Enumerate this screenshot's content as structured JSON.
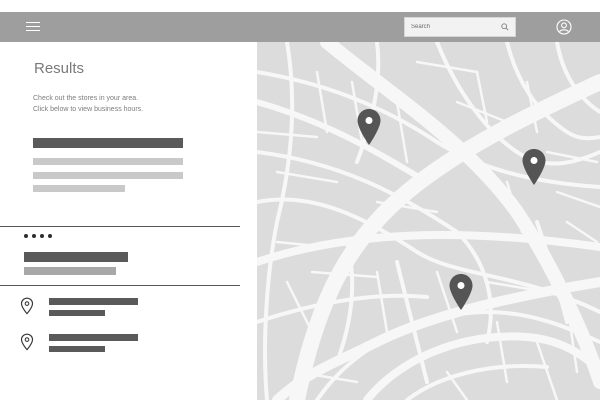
{
  "header": {
    "menu_icon": "hamburger-menu-icon",
    "search": {
      "placeholder": "Search",
      "icon": "search-icon"
    },
    "user_icon": "user-account-icon"
  },
  "results": {
    "title": "Results",
    "intro_lines": [
      "Check out the stores in your area.",
      "Click below to view business hours."
    ],
    "more_icon": "more-dots-icon",
    "location_icon": "map-pin-outline-icon"
  },
  "map": {
    "marker_icon": "map-marker-icon",
    "marker_count": 3
  },
  "colors": {
    "header_bg": "#9e9e9e",
    "map_bg": "#dcdcdc",
    "road": "#f7f7f7",
    "marker": "#555555",
    "placeholder_dark": "#5a5a5a",
    "placeholder_light": "#c9c9c9"
  }
}
